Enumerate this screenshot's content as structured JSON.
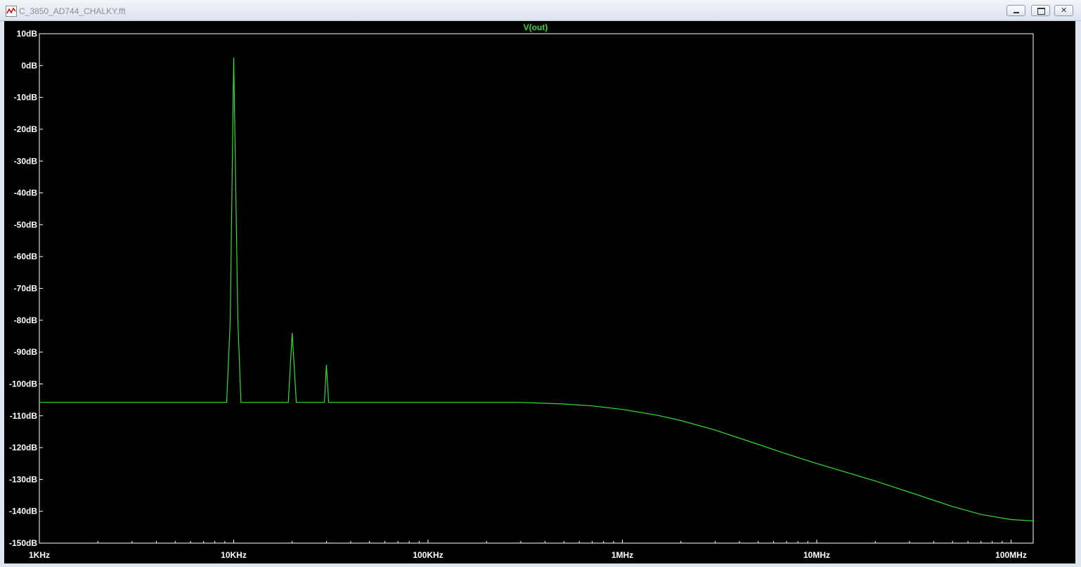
{
  "window": {
    "title": "C_3850_AD744_CHALKY.fft",
    "icon": "waveform-icon"
  },
  "chart_data": {
    "type": "line",
    "trace_label": "V(out)",
    "x_scale": "log",
    "y_scale": "linear",
    "x_range": [
      1000,
      130000000
    ],
    "y_range": [
      -150,
      10
    ],
    "x_ticks": [
      {
        "value": 1000,
        "label": "1KHz"
      },
      {
        "value": 10000,
        "label": "10KHz"
      },
      {
        "value": 100000,
        "label": "100KHz"
      },
      {
        "value": 1000000,
        "label": "1MHz"
      },
      {
        "value": 10000000,
        "label": "10MHz"
      },
      {
        "value": 100000000,
        "label": "100MHz"
      }
    ],
    "y_ticks": [
      {
        "value": 10,
        "label": "10dB"
      },
      {
        "value": 0,
        "label": "0dB"
      },
      {
        "value": -10,
        "label": "-10dB"
      },
      {
        "value": -20,
        "label": "-20dB"
      },
      {
        "value": -30,
        "label": "-30dB"
      },
      {
        "value": -40,
        "label": "-40dB"
      },
      {
        "value": -50,
        "label": "-50dB"
      },
      {
        "value": -60,
        "label": "-60dB"
      },
      {
        "value": -70,
        "label": "-70dB"
      },
      {
        "value": -80,
        "label": "-80dB"
      },
      {
        "value": -90,
        "label": "-90dB"
      },
      {
        "value": -100,
        "label": "-100dB"
      },
      {
        "value": -110,
        "label": "-110dB"
      },
      {
        "value": -120,
        "label": "-120dB"
      },
      {
        "value": -130,
        "label": "-130dB"
      },
      {
        "value": -140,
        "label": "-140dB"
      },
      {
        "value": -150,
        "label": "-150dB"
      }
    ],
    "series": [
      {
        "color": "#33dd33",
        "points": [
          [
            1000,
            -105.8
          ],
          [
            9200,
            -105.8
          ],
          [
            9600,
            -80
          ],
          [
            10000,
            2.5
          ],
          [
            10500,
            -80
          ],
          [
            10900,
            -105.8
          ],
          [
            19100,
            -105.8
          ],
          [
            20000,
            -84
          ],
          [
            21000,
            -105.8
          ],
          [
            29300,
            -105.8
          ],
          [
            30000,
            -94
          ],
          [
            30800,
            -105.8
          ],
          [
            300000,
            -105.8
          ],
          [
            500000,
            -106.3
          ],
          [
            700000,
            -106.9
          ],
          [
            1000000,
            -108
          ],
          [
            1500000,
            -109.8
          ],
          [
            2000000,
            -111.5
          ],
          [
            3000000,
            -114.5
          ],
          [
            5000000,
            -119
          ],
          [
            7000000,
            -122
          ],
          [
            10000000,
            -125
          ],
          [
            15000000,
            -128.2
          ],
          [
            20000000,
            -130.5
          ],
          [
            30000000,
            -134
          ],
          [
            50000000,
            -138.5
          ],
          [
            70000000,
            -141
          ],
          [
            100000000,
            -142.6
          ],
          [
            130000000,
            -143
          ]
        ]
      }
    ],
    "grid": false,
    "background": "#000000",
    "axis_color": "#ffffff"
  }
}
